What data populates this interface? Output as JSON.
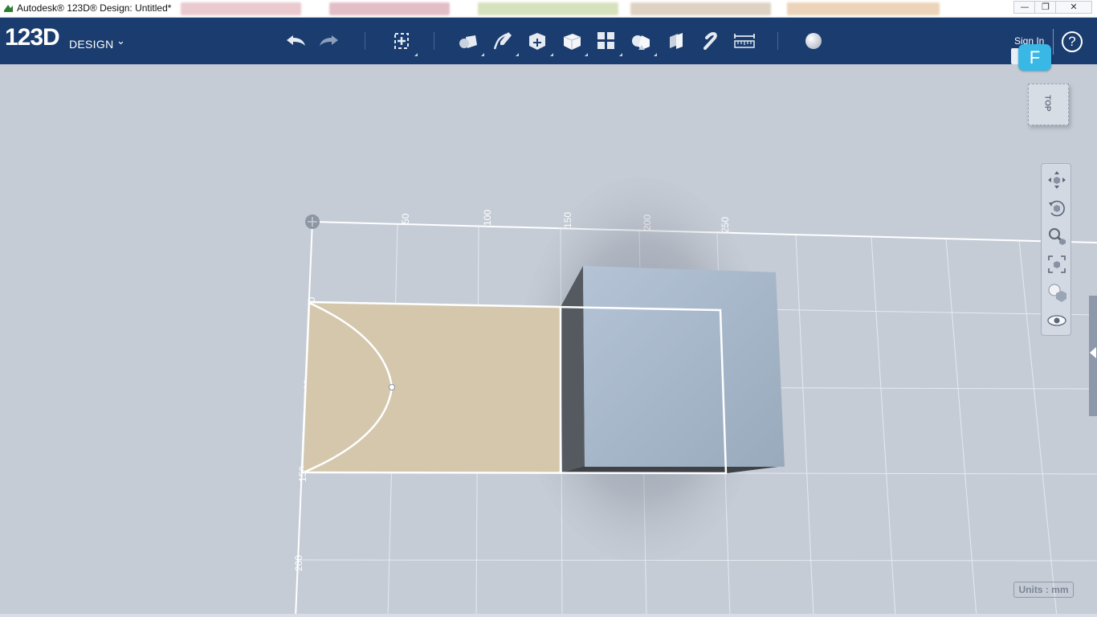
{
  "window": {
    "title": "Autodesk® 123D® Design: Untitled*",
    "minimize_glyph": "—",
    "restore_glyph": "❐",
    "close_glyph": "✕"
  },
  "toolbar": {
    "logo_main": "123D",
    "logo_sub": "DESIGN",
    "logo_chevron": "⌄",
    "sign_in": "Sign In",
    "help": "?",
    "user_badge": "F",
    "tools": [
      {
        "name": "undo-icon"
      },
      {
        "name": "redo-icon"
      },
      {
        "name": "transform-icon"
      },
      {
        "name": "primitives-icon"
      },
      {
        "name": "sketch-icon"
      },
      {
        "name": "construct-icon"
      },
      {
        "name": "modify-icon"
      },
      {
        "name": "pattern-icon"
      },
      {
        "name": "grouping-icon"
      },
      {
        "name": "combine-icon"
      },
      {
        "name": "snap-icon"
      },
      {
        "name": "measure-icon"
      },
      {
        "name": "material-icon"
      }
    ]
  },
  "viewport": {
    "viewcube_face": "TOP",
    "units_label": "Units : mm",
    "grid_labels_top": [
      "50",
      "100",
      "150",
      "200",
      "250"
    ],
    "grid_labels_left": [
      "50",
      "100",
      "150",
      "200"
    ],
    "nav_tools": [
      "pan-icon",
      "orbit-icon",
      "zoom-icon",
      "fit-icon",
      "view-mode-icon",
      "visibility-icon"
    ]
  },
  "colors": {
    "toolbar_bg": "#1a3c6e",
    "viewport_bg": "#c5ccd6",
    "sketch_fill": "#d4c7ac",
    "box_front": "#a3b4c6",
    "box_side": "#555a60",
    "badge": "#39b8e6"
  }
}
